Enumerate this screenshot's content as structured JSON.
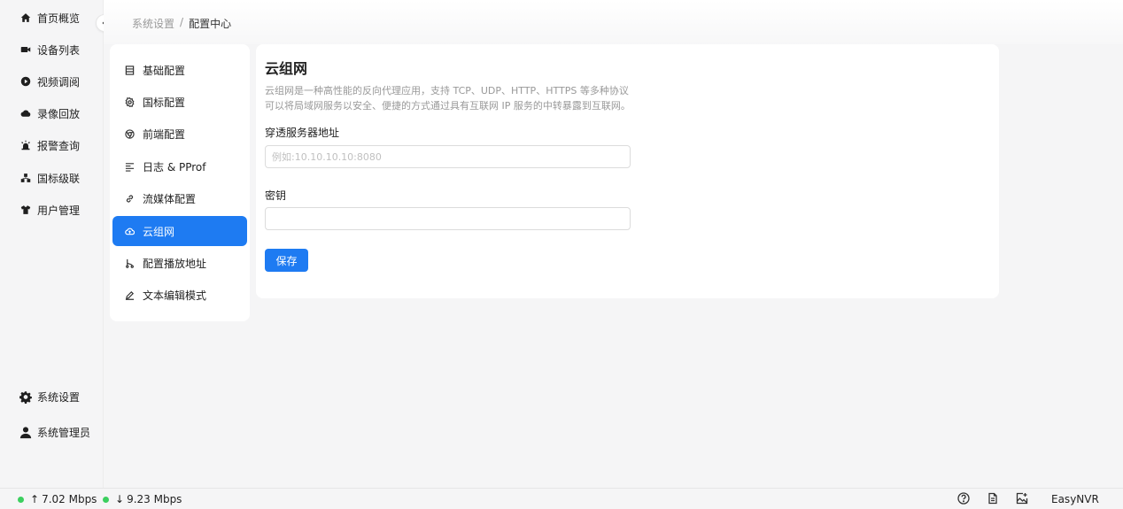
{
  "sidebar": {
    "items": [
      {
        "label": "首页概览",
        "icon": "home-icon"
      },
      {
        "label": "设备列表",
        "icon": "video-camera-icon"
      },
      {
        "label": "视频调阅",
        "icon": "play-circle-icon"
      },
      {
        "label": "录像回放",
        "icon": "cloud-icon"
      },
      {
        "label": "报警查询",
        "icon": "alarm-icon"
      },
      {
        "label": "国标级联",
        "icon": "cluster-icon"
      },
      {
        "label": "用户管理",
        "icon": "shirt-icon"
      }
    ],
    "bottom": [
      {
        "label": "系统设置",
        "icon": "gear-icon"
      },
      {
        "label": "系统管理员",
        "icon": "user-icon"
      }
    ]
  },
  "breadcrumb": {
    "parent": "系统设置",
    "separator": "/",
    "current": "配置中心"
  },
  "config_menu": {
    "items": [
      {
        "label": "基础配置",
        "icon": "list-icon"
      },
      {
        "label": "国标配置",
        "icon": "gear-outline-icon"
      },
      {
        "label": "前端配置",
        "icon": "chrome-icon"
      },
      {
        "label": "日志 & PProf",
        "icon": "align-left-icon"
      },
      {
        "label": "流媒体配置",
        "icon": "link-icon"
      },
      {
        "label": "云组网",
        "icon": "cloud-upload-icon"
      },
      {
        "label": "配置播放地址",
        "icon": "branch-icon"
      },
      {
        "label": "文本编辑模式",
        "icon": "edit-icon"
      }
    ],
    "active_index": 5
  },
  "panel": {
    "title": "云组网",
    "desc_line1": "云组网是一种高性能的反向代理应用，支持 TCP、UDP、HTTP、HTTPS 等多种协议",
    "desc_line2": "可以将局域网服务以安全、便捷的方式通过具有互联网 IP 服务的中转暴露到互联网。",
    "server_label": "穿透服务器地址",
    "server_placeholder": "例如:10.10.10.10:8080",
    "server_value": "",
    "secret_label": "密钥",
    "secret_value": "",
    "save_label": "保存"
  },
  "footer": {
    "upload": "7.02 Mbps",
    "download": "9.23 Mbps",
    "up_arrow": "↑",
    "down_arrow": "↓",
    "brand": "EasyNVR"
  },
  "colors": {
    "accent": "#1e7bf2",
    "status_ok": "#3ccf5f"
  }
}
